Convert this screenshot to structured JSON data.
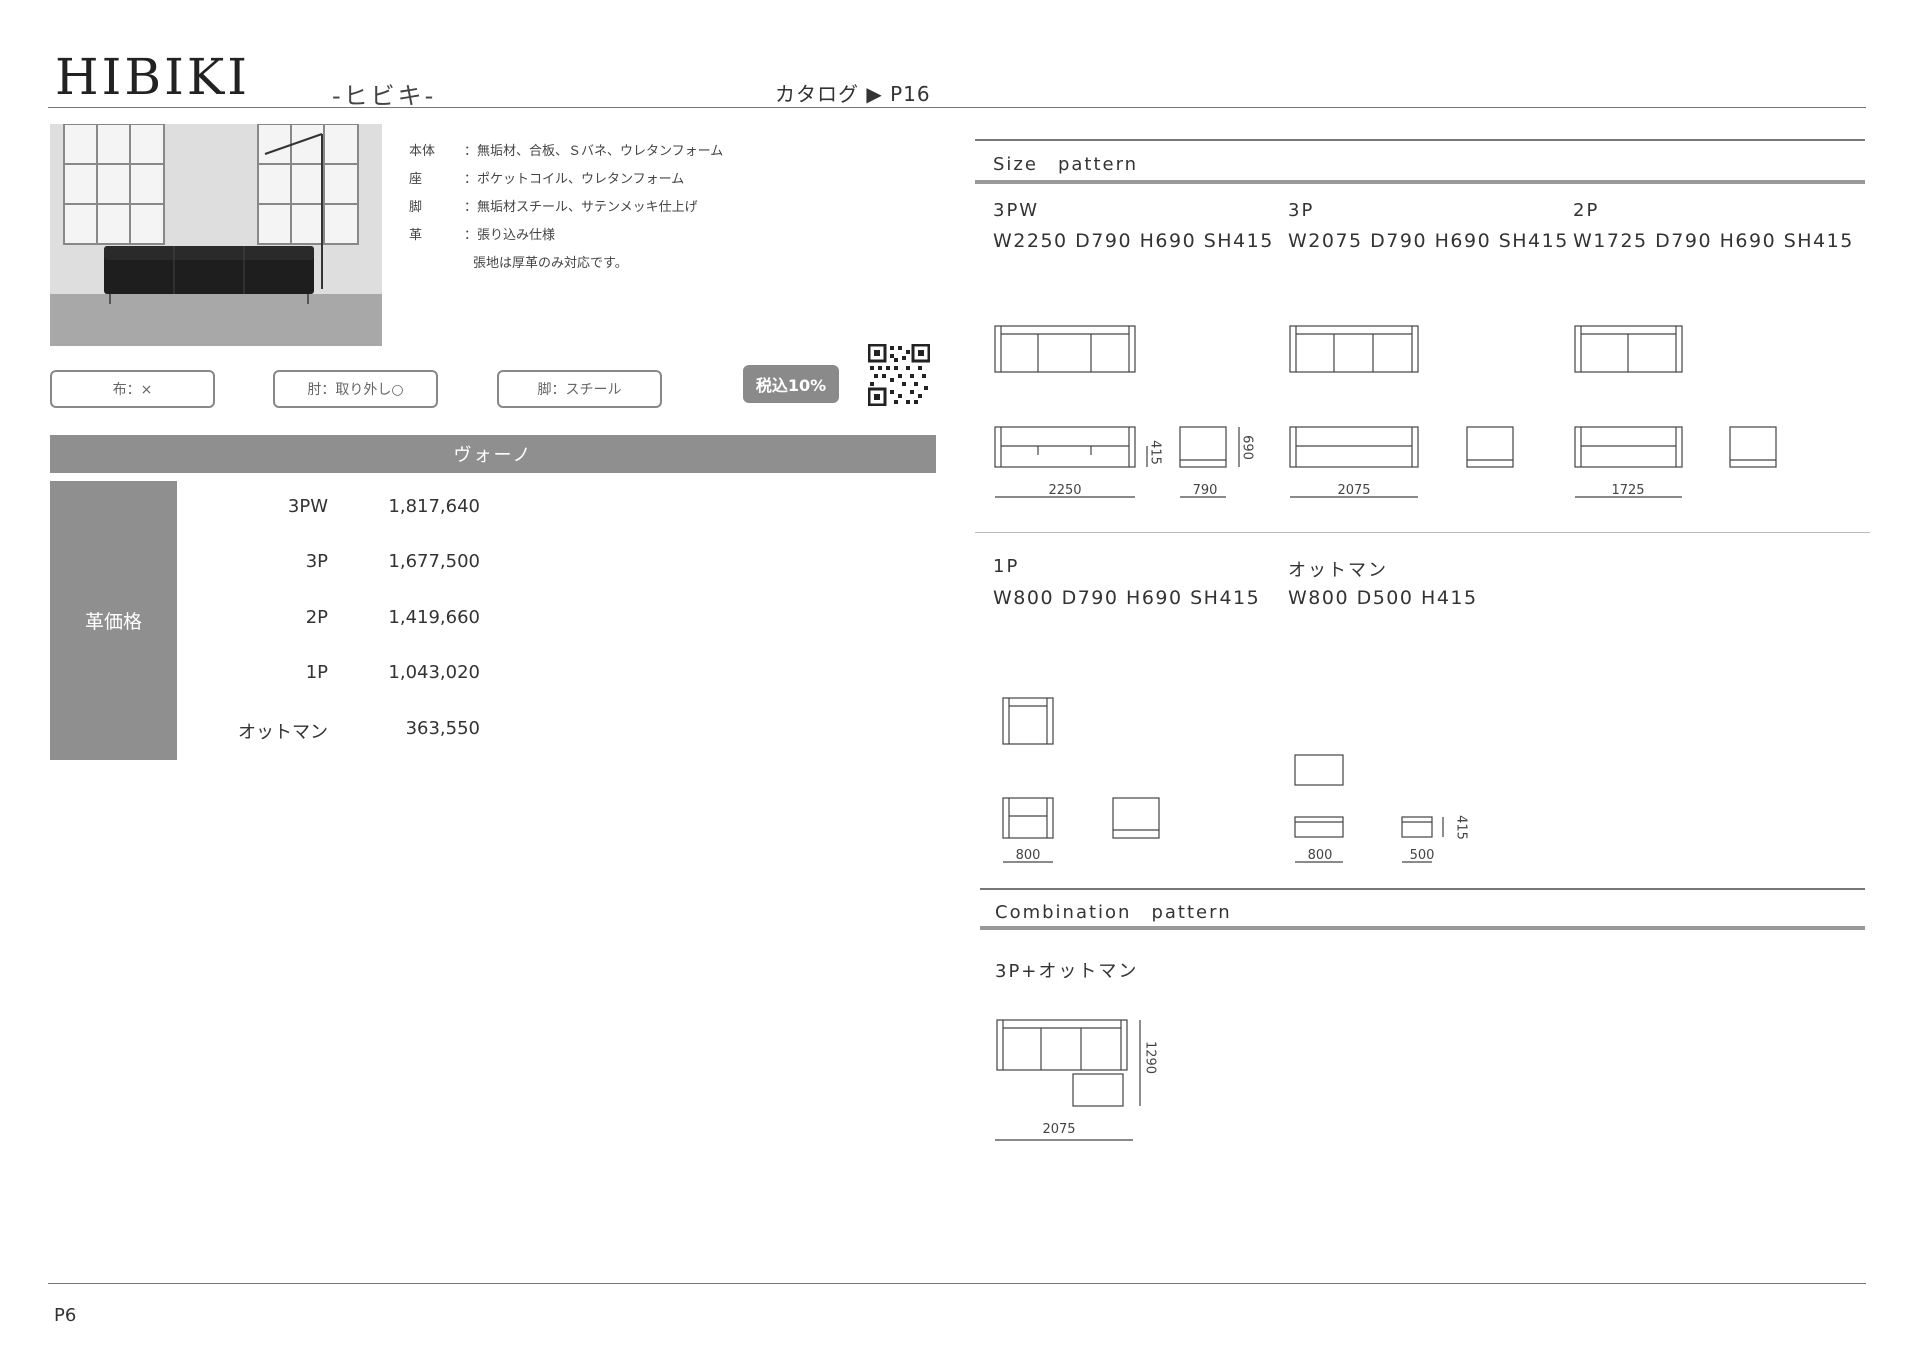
{
  "header": {
    "title": "HIBIKI",
    "kana": "-ヒビキ-",
    "catalog": "カタログ ▶ P16"
  },
  "specs": [
    {
      "label": "本体",
      "value": "：無垢材、合板、Ｓバネ、ウレタンフォーム"
    },
    {
      "label": "座",
      "value": "：ポケットコイル、ウレタンフォーム"
    },
    {
      "label": "脚",
      "value": "：無垢材スチール、サテンメッキ仕上げ"
    },
    {
      "label": "革",
      "value": "：張り込み仕様"
    },
    {
      "label": "",
      "value": "張地は厚革のみ対応です。"
    }
  ],
  "tags": [
    "布：×",
    "肘：取り外し○",
    "脚：スチール"
  ],
  "tax": "税込10%",
  "price_table": {
    "header": "ヴォーノ",
    "category": "革価格",
    "rows": [
      {
        "model": "3PW",
        "price": "1,817,640"
      },
      {
        "model": "3P",
        "price": "1,677,500"
      },
      {
        "model": "2P",
        "price": "1,419,660"
      },
      {
        "model": "1P",
        "price": "1,043,020"
      },
      {
        "model": "オットマン",
        "price": "363,550"
      }
    ]
  },
  "size_pattern": {
    "heading": "Size　pattern",
    "items": [
      {
        "model": "3PW",
        "dims": "W2250 D790 H690 SH415",
        "w": "2250",
        "d": "790",
        "h": "690",
        "sh": "415"
      },
      {
        "model": "3P",
        "dims": "W2075 D790 H690 SH415",
        "w": "2075"
      },
      {
        "model": "2P",
        "dims": "W1725 D790 H690 SH415",
        "w": "1725"
      },
      {
        "model": "1P",
        "dims": "W800 D790 H690 SH415",
        "w": "800"
      },
      {
        "model": "オットマン",
        "dims": "W800 D500 H415",
        "w": "800",
        "d": "500",
        "h": "415"
      }
    ]
  },
  "combination_pattern": {
    "heading": "Combination　pattern",
    "model": "3P+オットマン",
    "width": "2075",
    "depth": "1290"
  },
  "footer": {
    "page": "P6"
  }
}
